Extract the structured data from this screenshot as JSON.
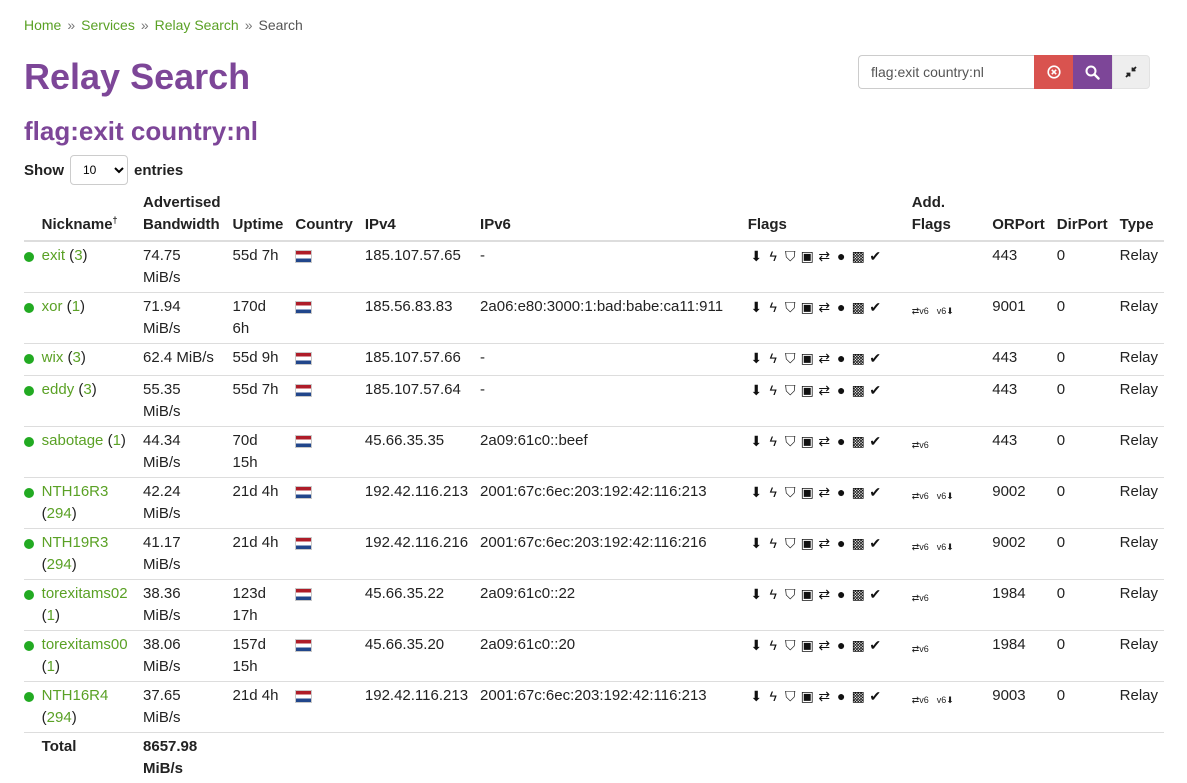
{
  "breadcrumb": {
    "home": "Home",
    "services": "Services",
    "relay_search": "Relay Search",
    "current": "Search",
    "sep": "»"
  },
  "page_title": "Relay Search",
  "query_title": "flag:exit country:nl",
  "search": {
    "value": "flag:exit country:nl",
    "clear_icon": "clear-circle-icon",
    "search_icon": "magnifier-icon",
    "collapse_icon": "compress-arrows-icon"
  },
  "show_entries": {
    "prefix": "Show",
    "selected": "10",
    "suffix": "entries"
  },
  "table": {
    "headers": {
      "nickname": "Nickname",
      "nickname_sup": "†",
      "bandwidth_line1": "Advertised",
      "bandwidth_line2": "Bandwidth",
      "uptime": "Uptime",
      "country": "Country",
      "ipv4": "IPv4",
      "ipv6": "IPv6",
      "flags": "Flags",
      "add_flags": "Add. Flags",
      "orport": "ORPort",
      "dirport": "DirPort",
      "type": "Type"
    },
    "flag_icons": [
      "exit-icon",
      "fast-icon",
      "guard-icon",
      "hsdir-icon",
      "running-icon",
      "stable-icon",
      "v2dir-icon",
      "valid-icon"
    ],
    "flag_glyphs": [
      "⬇",
      "ϟ",
      "⛉",
      "▣",
      "⇄",
      "●",
      "▩",
      "✔"
    ],
    "rows": [
      {
        "nickname": "exit",
        "family": "3",
        "bandwidth": "74.75 MiB/s",
        "uptime": "55d 7h",
        "ipv4": "185.107.57.65",
        "ipv6": "-",
        "add_flags": [],
        "orport": "443",
        "dirport": "0",
        "type": "Relay"
      },
      {
        "nickname": "xor",
        "family": "1",
        "bandwidth": "71.94 MiB/s",
        "uptime": "170d 6h",
        "ipv4": "185.56.83.83",
        "ipv6": "2a06:e80:3000:1:bad:babe:ca11:911",
        "add_flags": [
          "⇄v6",
          "v6⬇"
        ],
        "orport": "9001",
        "dirport": "0",
        "type": "Relay"
      },
      {
        "nickname": "wix",
        "family": "3",
        "bandwidth": "62.4 MiB/s",
        "uptime": "55d 9h",
        "ipv4": "185.107.57.66",
        "ipv6": "-",
        "add_flags": [],
        "orport": "443",
        "dirport": "0",
        "type": "Relay"
      },
      {
        "nickname": "eddy",
        "family": "3",
        "bandwidth": "55.35 MiB/s",
        "uptime": "55d 7h",
        "ipv4": "185.107.57.64",
        "ipv6": "-",
        "add_flags": [],
        "orport": "443",
        "dirport": "0",
        "type": "Relay"
      },
      {
        "nickname": "sabotage",
        "family": "1",
        "bandwidth": "44.34 MiB/s",
        "uptime": "70d 15h",
        "ipv4": "45.66.35.35",
        "ipv6": "2a09:61c0::beef",
        "add_flags": [
          "⇄v6"
        ],
        "orport": "443",
        "dirport": "0",
        "type": "Relay"
      },
      {
        "nickname": "NTH16R3",
        "family": "294",
        "bandwidth": "42.24 MiB/s",
        "uptime": "21d 4h",
        "ipv4": "192.42.116.213",
        "ipv6": "2001:67c:6ec:203:192:42:116:213",
        "add_flags": [
          "⇄v6",
          "v6⬇"
        ],
        "orport": "9002",
        "dirport": "0",
        "type": "Relay"
      },
      {
        "nickname": "NTH19R3",
        "family": "294",
        "bandwidth": "41.17 MiB/s",
        "uptime": "21d 4h",
        "ipv4": "192.42.116.216",
        "ipv6": "2001:67c:6ec:203:192:42:116:216",
        "add_flags": [
          "⇄v6",
          "v6⬇"
        ],
        "orport": "9002",
        "dirport": "0",
        "type": "Relay"
      },
      {
        "nickname": "torexitams02",
        "family": "1",
        "bandwidth": "38.36 MiB/s",
        "uptime": "123d 17h",
        "ipv4": "45.66.35.22",
        "ipv6": "2a09:61c0::22",
        "add_flags": [
          "⇄v6"
        ],
        "orport": "1984",
        "dirport": "0",
        "type": "Relay"
      },
      {
        "nickname": "torexitams00",
        "family": "1",
        "bandwidth": "38.06 MiB/s",
        "uptime": "157d 15h",
        "ipv4": "45.66.35.20",
        "ipv6": "2a09:61c0::20",
        "add_flags": [
          "⇄v6"
        ],
        "orport": "1984",
        "dirport": "0",
        "type": "Relay"
      },
      {
        "nickname": "NTH16R4",
        "family": "294",
        "bandwidth": "37.65 MiB/s",
        "uptime": "21d 4h",
        "ipv4": "192.42.116.213",
        "ipv6": "2001:67c:6ec:203:192:42:116:213",
        "add_flags": [
          "⇄v6",
          "v6⬇"
        ],
        "orport": "9003",
        "dirport": "0",
        "type": "Relay"
      }
    ],
    "total": {
      "label": "Total",
      "bandwidth": "8657.98 MiB/s"
    }
  },
  "colors": {
    "accent_purple": "#7d4698",
    "link_green": "#5aa125",
    "status_green": "#22aa22",
    "clear_red": "#d9534f"
  }
}
